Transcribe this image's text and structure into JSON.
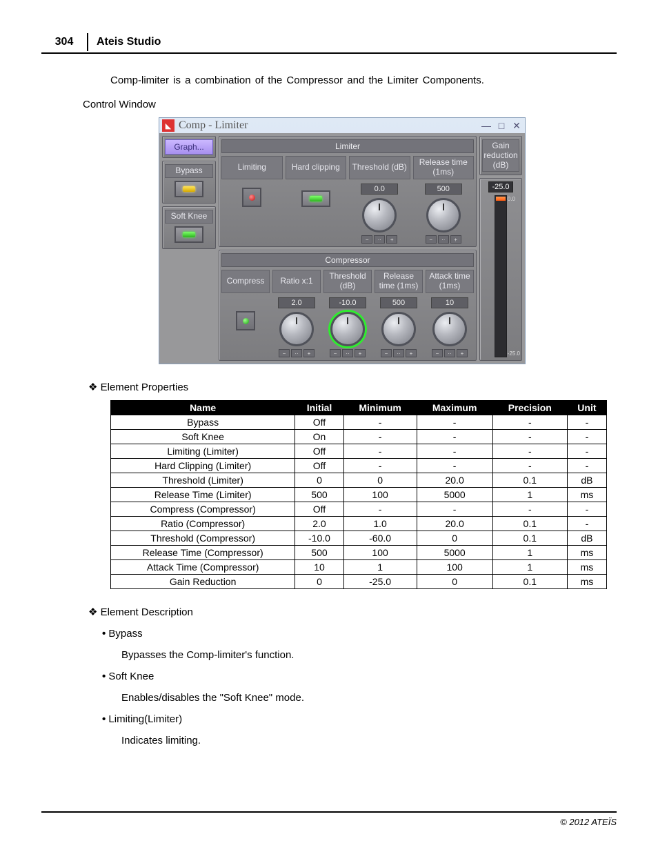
{
  "header": {
    "page_number": "304",
    "manual_title": "Ateis Studio"
  },
  "intro_text": "Comp-limiter  is a combination of the Compressor and the Limiter Components.",
  "section_control_window": "Control Window",
  "control_window": {
    "title": "Comp - Limiter",
    "graph_button": "Graph...",
    "bypass_label": "Bypass",
    "softknee_label": "Soft Knee",
    "limiter": {
      "group_label": "Limiter",
      "limiting_label": "Limiting",
      "hardclip_label": "Hard clipping",
      "threshold_label": "Threshold (dB)",
      "release_label": "Release time (1ms)",
      "threshold_value": "0.0",
      "release_value": "500"
    },
    "compressor": {
      "group_label": "Compressor",
      "compress_label": "Compress",
      "ratio_label": "Ratio x:1",
      "threshold_label": "Threshold (dB)",
      "release_label": "Release time (1ms)",
      "attack_label": "Attack time (1ms)",
      "ratio_value": "2.0",
      "threshold_value": "-10.0",
      "release_value": "500",
      "attack_value": "10"
    },
    "gain_reduction": {
      "label": "Gain reduction (dB)",
      "value": "-25.0",
      "top_tick": "0.0",
      "bottom_tick": "-25.0"
    }
  },
  "section_properties": "Element Properties",
  "table": {
    "headers": [
      "Name",
      "Initial",
      "Minimum",
      "Maximum",
      "Precision",
      "Unit"
    ],
    "rows": [
      [
        "Bypass",
        "Off",
        "-",
        "-",
        "-",
        "-"
      ],
      [
        "Soft Knee",
        "On",
        "-",
        "-",
        "-",
        "-"
      ],
      [
        "Limiting (Limiter)",
        "Off",
        "-",
        "-",
        "-",
        "-"
      ],
      [
        "Hard Clipping (Limiter)",
        "Off",
        "-",
        "-",
        "-",
        "-"
      ],
      [
        "Threshold (Limiter)",
        "0",
        "0",
        "20.0",
        "0.1",
        "dB"
      ],
      [
        "Release Time (Limiter)",
        "500",
        "100",
        "5000",
        "1",
        "ms"
      ],
      [
        "Compress (Compressor)",
        "Off",
        "-",
        "-",
        "-",
        "-"
      ],
      [
        "Ratio (Compressor)",
        "2.0",
        "1.0",
        "20.0",
        "0.1",
        "-"
      ],
      [
        "Threshold (Compressor)",
        "-10.0",
        "-60.0",
        "0",
        "0.1",
        "dB"
      ],
      [
        "Release Time (Compressor)",
        "500",
        "100",
        "5000",
        "1",
        "ms"
      ],
      [
        "Attack Time (Compressor)",
        "10",
        "1",
        "100",
        "1",
        "ms"
      ],
      [
        "Gain Reduction",
        "0",
        "-25.0",
        "0",
        "0.1",
        "ms"
      ]
    ]
  },
  "section_description": "Element Description",
  "descriptions": [
    {
      "title": "Bypass",
      "body": "Bypasses the Comp-limiter's function."
    },
    {
      "title": "Soft Knee",
      "body": "Enables/disables the \"Soft Knee\" mode."
    },
    {
      "title": "Limiting(Limiter)",
      "body": "Indicates limiting."
    }
  ],
  "footer": "© 2012 ATEÏS"
}
